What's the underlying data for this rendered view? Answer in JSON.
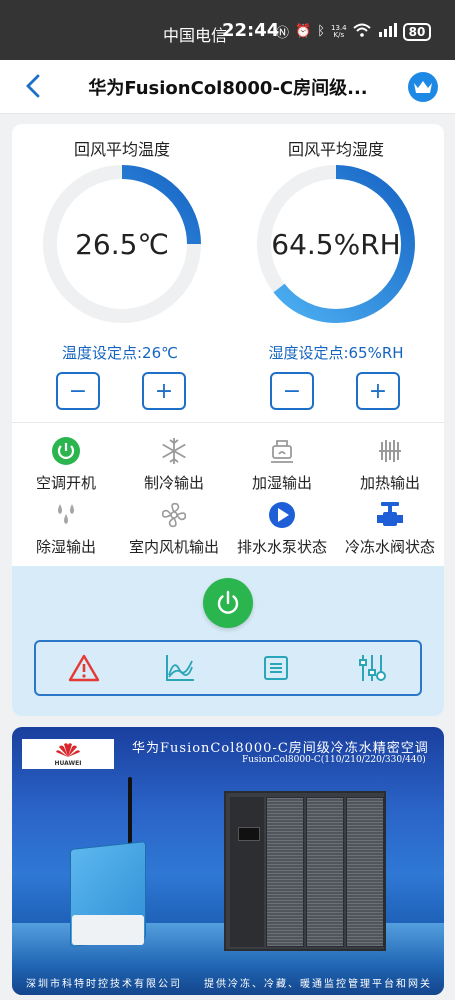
{
  "statusbar": {
    "carrier": "中国电信",
    "time": "22:44",
    "net_speed_value": "13.4",
    "net_speed_unit": "K/s",
    "battery": "80"
  },
  "nav": {
    "title": "华为FusionCol8000-C房间级..."
  },
  "gauges": {
    "temperature": {
      "label": "回风平均温度",
      "value": "26.5℃",
      "fraction": 0.25,
      "setpoint": "温度设定点:26℃"
    },
    "humidity": {
      "label": "回风平均湿度",
      "value": "64.5%RH",
      "fraction": 0.645,
      "setpoint": "湿度设定点:65%RH"
    }
  },
  "steppers": {
    "minus": "−",
    "plus": "+"
  },
  "status_items": [
    {
      "label": "空调开机",
      "icon": "power-on-icon"
    },
    {
      "label": "制冷输出",
      "icon": "snowflake-icon"
    },
    {
      "label": "加湿输出",
      "icon": "humidifier-icon"
    },
    {
      "label": "加热输出",
      "icon": "heater-icon"
    },
    {
      "label": "除湿输出",
      "icon": "droplets-icon"
    },
    {
      "label": "室内风机输出",
      "icon": "fan-icon"
    },
    {
      "label": "排水水泵状态",
      "icon": "pump-icon"
    },
    {
      "label": "冷冻水阀状态",
      "icon": "valve-icon"
    }
  ],
  "colors": {
    "accent": "#1e6fc8",
    "setpoint_text": "#1565c0",
    "power_green": "#2bb54f",
    "alarm_red": "#e53935",
    "control_bg": "#d7ebf8"
  },
  "toolbar": {
    "items": [
      "alarm-icon",
      "curve-chart-icon",
      "list-icon",
      "settings-sliders-icon"
    ]
  },
  "banner": {
    "logo_text": "HUAWEI",
    "title": "华为FusionCol8000-C房间级冷冻水精密空调",
    "subtitle": "FusionCol8000-C(110/210/220/330/440)",
    "footer_left": "深圳市科特时控技术有限公司",
    "footer_right": "提供冷冻、冷藏、暖通监控管理平台和网关"
  }
}
